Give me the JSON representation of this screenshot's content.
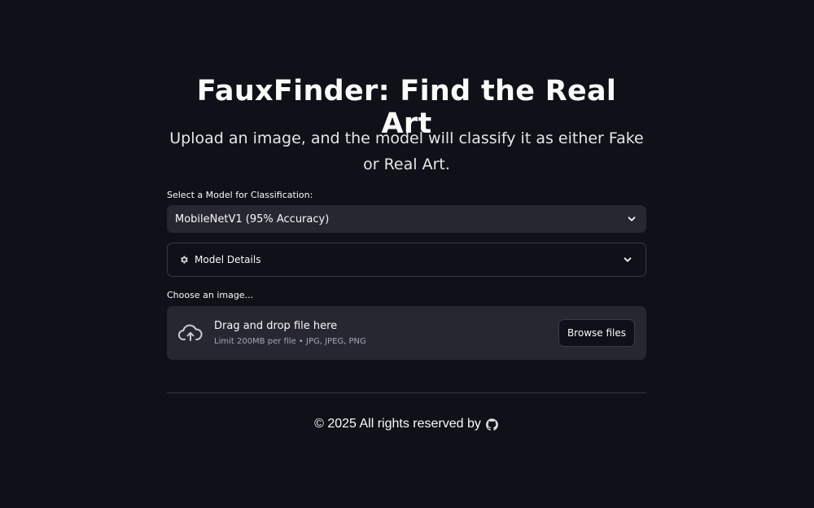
{
  "header": {
    "title": "FauxFinder: Find the Real Art",
    "subtitle": "Upload an image, and the model will classify it as either Fake or Real Art."
  },
  "model_select": {
    "label": "Select a Model for Classification:",
    "selected": "MobileNetV1 (95% Accuracy)",
    "icon": "chevron-down-icon"
  },
  "expander": {
    "label": "Model Details",
    "icon": "gear-icon",
    "chevron_icon": "chevron-down-icon"
  },
  "uploader": {
    "label": "Choose an image...",
    "drop_text": "Drag and drop file here",
    "limit_text": "Limit 200MB per file • JPG, JPEG, PNG",
    "browse_label": "Browse files",
    "icon": "cloud-upload-icon"
  },
  "footer": {
    "text": "© 2025 All rights reserved by",
    "icon": "github-icon"
  },
  "colors": {
    "background": "#0e1117",
    "surface": "#262730",
    "text": "#fafafa",
    "muted": "#a3a8b8",
    "border": "#3a3b45"
  }
}
